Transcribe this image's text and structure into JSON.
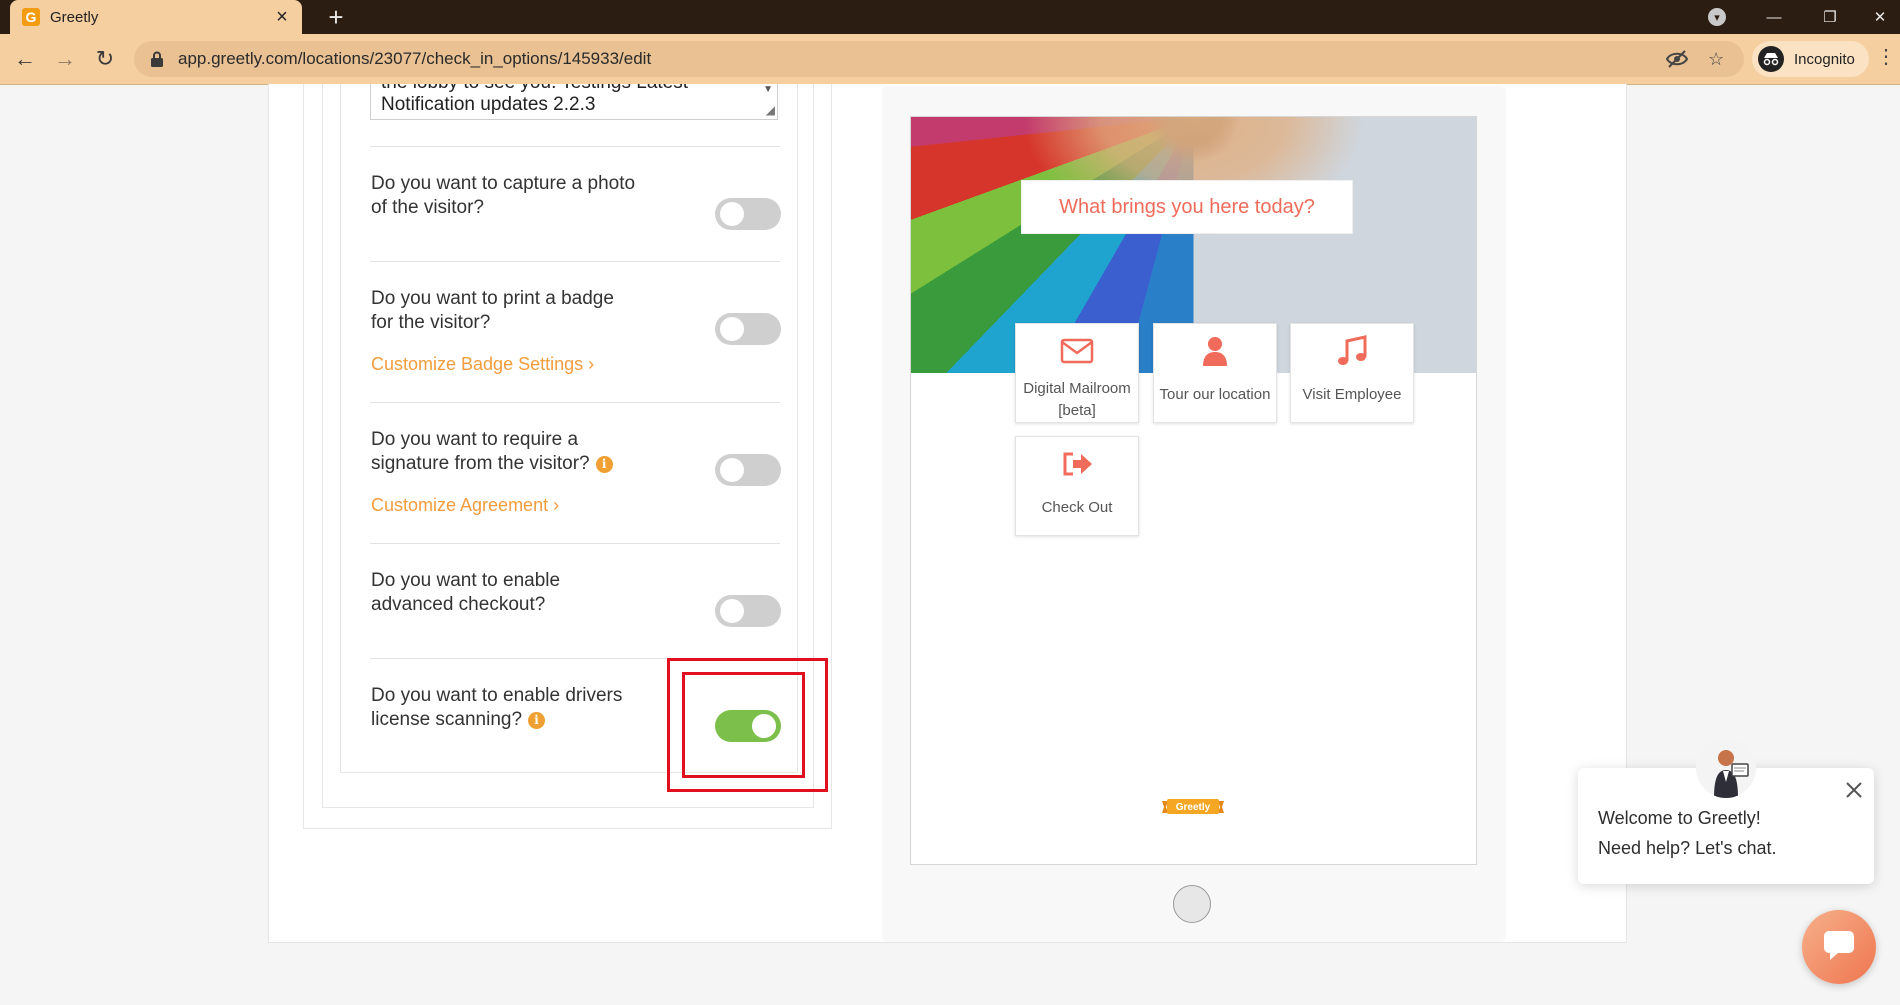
{
  "browser": {
    "tab_title": "Greetly",
    "tab_favicon_letter": "G",
    "url": "app.greetly.com/locations/23077/check_in_options/145933/edit",
    "incognito_label": "Incognito"
  },
  "form": {
    "textarea_line1": "the lobby to see you. Testings Latest",
    "textarea_line2": "Notification updates 2.2.3",
    "questions": [
      {
        "line1": "Do you want to capture a photo",
        "line2": "of the visitor?",
        "enabled": false
      },
      {
        "line1": "Do you want to print a badge",
        "line2": "for the visitor?",
        "enabled": false,
        "link": "Customize Badge Settings ›"
      },
      {
        "line1": "Do you want to require a",
        "line2": "signature from the visitor?",
        "enabled": false,
        "link": "Customize Agreement ›"
      },
      {
        "line1": "Do you want to enable",
        "line2": "advanced checkout?",
        "enabled": false
      },
      {
        "line1": "Do you want to enable drivers",
        "line2": "license scanning?",
        "enabled": true
      }
    ],
    "info_glyph": "i"
  },
  "preview": {
    "title": "What brings you here today?",
    "tiles": [
      {
        "label": "Digital Mailroom [beta]",
        "icon": "envelope-icon"
      },
      {
        "label": "Tour our location",
        "icon": "person-icon"
      },
      {
        "label": "Visit Employee",
        "icon": "music-note-icon"
      },
      {
        "label": "Check Out",
        "icon": "sign-out-icon"
      }
    ],
    "brand_badge": "Greetly",
    "accent_color": "#f06b5a"
  },
  "chat": {
    "line1": "Welcome to Greetly!",
    "line2": "Need help? Let's chat."
  },
  "colors": {
    "toggle_on": "#7cc04b",
    "toggle_off": "#cfcfcf",
    "link": "#f39c3c",
    "highlight": "#e0101e"
  }
}
